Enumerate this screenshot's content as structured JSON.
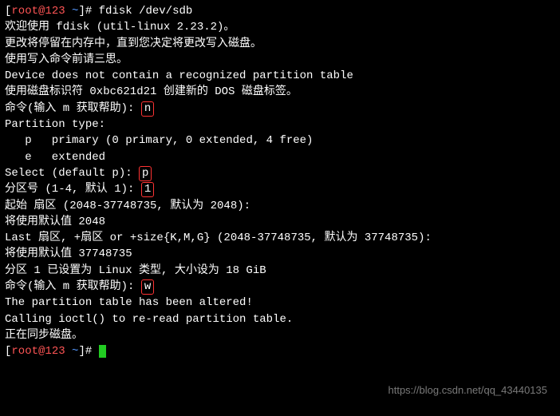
{
  "prompt": {
    "open": "[",
    "user": "root@123",
    "path": " ~",
    "close": "]# "
  },
  "lines": {
    "l1_cmd": "fdisk /dev/sdb",
    "l2": "欢迎使用 fdisk (util-linux 2.23.2)。",
    "l3": "",
    "l4": "更改将停留在内存中，直到您决定将更改写入磁盘。",
    "l5": "使用写入命令前请三思。",
    "l6": "",
    "l7": "",
    "l8": "Device does not contain a recognized partition table",
    "l9": "使用磁盘标识符 0xbc621d21 创建新的 DOS 磁盘标签。",
    "l10": "",
    "l11a": "命令(输入 m 获取帮助): ",
    "l11b": "n",
    "l12": "Partition type:",
    "l13": "   p   primary (0 primary, 0 extended, 4 free)",
    "l14": "   e   extended",
    "l15a": "Select (default p): ",
    "l15b": "p",
    "l16a": "分区号 (1-4, 默认 1): ",
    "l16b": "1",
    "l17": "起始 扇区 (2048-37748735, 默认为 2048):",
    "l18": "将使用默认值 2048",
    "l19": "Last 扇区, +扇区 or +size{K,M,G} (2048-37748735, 默认为 37748735):",
    "l20": "将使用默认值 37748735",
    "l21": "分区 1 已设置为 Linux 类型, 大小设为 18 GiB",
    "l22": "",
    "l23a": "命令(输入 m 获取帮助): ",
    "l23b": "w",
    "l24": "The partition table has been altered!",
    "l25": "",
    "l26": "Calling ioctl() to re-read partition table.",
    "l27": "正在同步磁盘。"
  },
  "watermark": "https://blog.csdn.net/qq_43440135"
}
